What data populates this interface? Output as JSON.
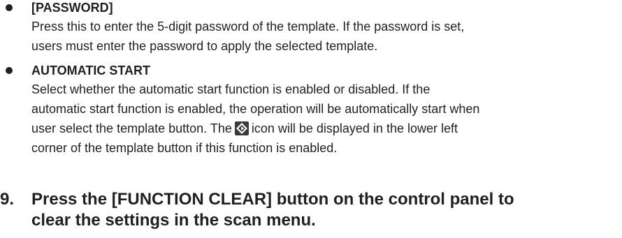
{
  "items": [
    {
      "title": "[PASSWORD]",
      "lines": [
        "Press this to enter the 5-digit password of the template.  If the password is set,",
        "users must enter the password to apply the selected template."
      ]
    },
    {
      "title": "AUTOMATIC START",
      "lines": [
        "Select whether the automatic start function is enabled or disabled.  If the",
        "automatic start function is enabled, the operation will be automatically start when"
      ],
      "icon_line_before": "user select the template button.  The",
      "icon_line_after": "icon will be displayed in the lower left",
      "last_line": "corner of the template button if this function is enabled.",
      "icon": "automatic-start-icon"
    }
  ],
  "step": {
    "number": "9.",
    "lines": [
      "Press the [FUNCTION CLEAR] button on the control panel to",
      "clear the settings in the scan menu."
    ]
  }
}
